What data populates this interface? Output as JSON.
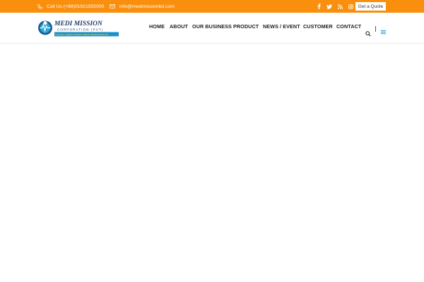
{
  "topbar": {
    "phone": "Call Us (+88)01921555000",
    "email": "info@medimissionbd.com",
    "quote_label": "Get a Quote",
    "bg_color": "#f98f0d",
    "socials": [
      "facebook-icon",
      "twitter-icon",
      "rss-icon",
      "instagram-icon"
    ]
  },
  "logo": {
    "title": "MEDI MISSION",
    "subtitle": "CORPORATION (PVT)",
    "tagline": "Importers, Supplier & Repair of Electro Medical Equipment"
  },
  "nav": {
    "items": [
      "HOME",
      "ABOUT",
      "OUR BUSINESS",
      "PRODUCT",
      "NEWS / EVENT",
      "CUSTOMER",
      "CONTACT"
    ]
  },
  "header": {
    "icons": [
      "search-icon",
      "menu-icon"
    ],
    "accent": "#1a8fc8"
  }
}
